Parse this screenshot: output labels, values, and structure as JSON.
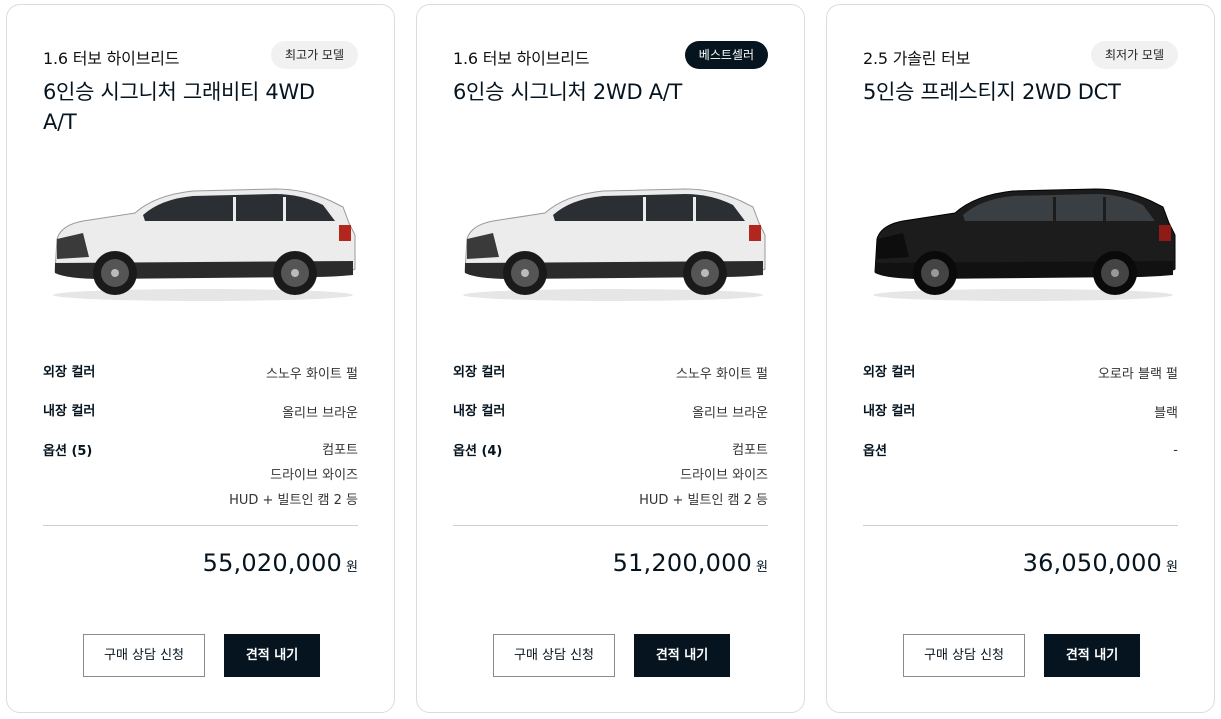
{
  "cards": [
    {
      "engine": "1.6 터보 하이브리드",
      "badge": "최고가 모델",
      "title": "6인승 시그니처 그래비티 4WD A/T",
      "car_color": "white",
      "exterior_label": "외장 컬러",
      "exterior_value": "스노우 화이트 펄",
      "interior_label": "내장 컬러",
      "interior_value": "올리브 브라운",
      "options_label": "옵션 (5)",
      "options": [
        "컴포트",
        "드라이브 와이즈",
        "HUD + 빌트인 캠 2 등"
      ],
      "price": "55,020,000",
      "currency": "원",
      "consult_button": "구매 상담 신청",
      "quote_button": "견적 내기"
    },
    {
      "engine": "1.6 터보 하이브리드",
      "badge": "베스트셀러",
      "title": "6인승 시그니처 2WD A/T",
      "car_color": "white",
      "exterior_label": "외장 컬러",
      "exterior_value": "스노우 화이트 펄",
      "interior_label": "내장 컬러",
      "interior_value": "올리브 브라운",
      "options_label": "옵션 (4)",
      "options": [
        "컴포트",
        "드라이브 와이즈",
        "HUD + 빌트인 캠 2 등"
      ],
      "price": "51,200,000",
      "currency": "원",
      "consult_button": "구매 상담 신청",
      "quote_button": "견적 내기"
    },
    {
      "engine": "2.5 가솔린 터보",
      "badge": "최저가 모델",
      "title": "5인승 프레스티지 2WD DCT",
      "car_color": "black",
      "exterior_label": "외장 컬러",
      "exterior_value": "오로라 블랙 펄",
      "interior_label": "내장 컬러",
      "interior_value": "블랙",
      "options_label": "옵션",
      "options": [
        "-"
      ],
      "price": "36,050,000",
      "currency": "원",
      "consult_button": "구매 상담 신청",
      "quote_button": "견적 내기"
    }
  ],
  "colors": {
    "brand_dark": "#05141f",
    "border": "#dcdcdc",
    "badge_light": "#f1f1f1"
  }
}
